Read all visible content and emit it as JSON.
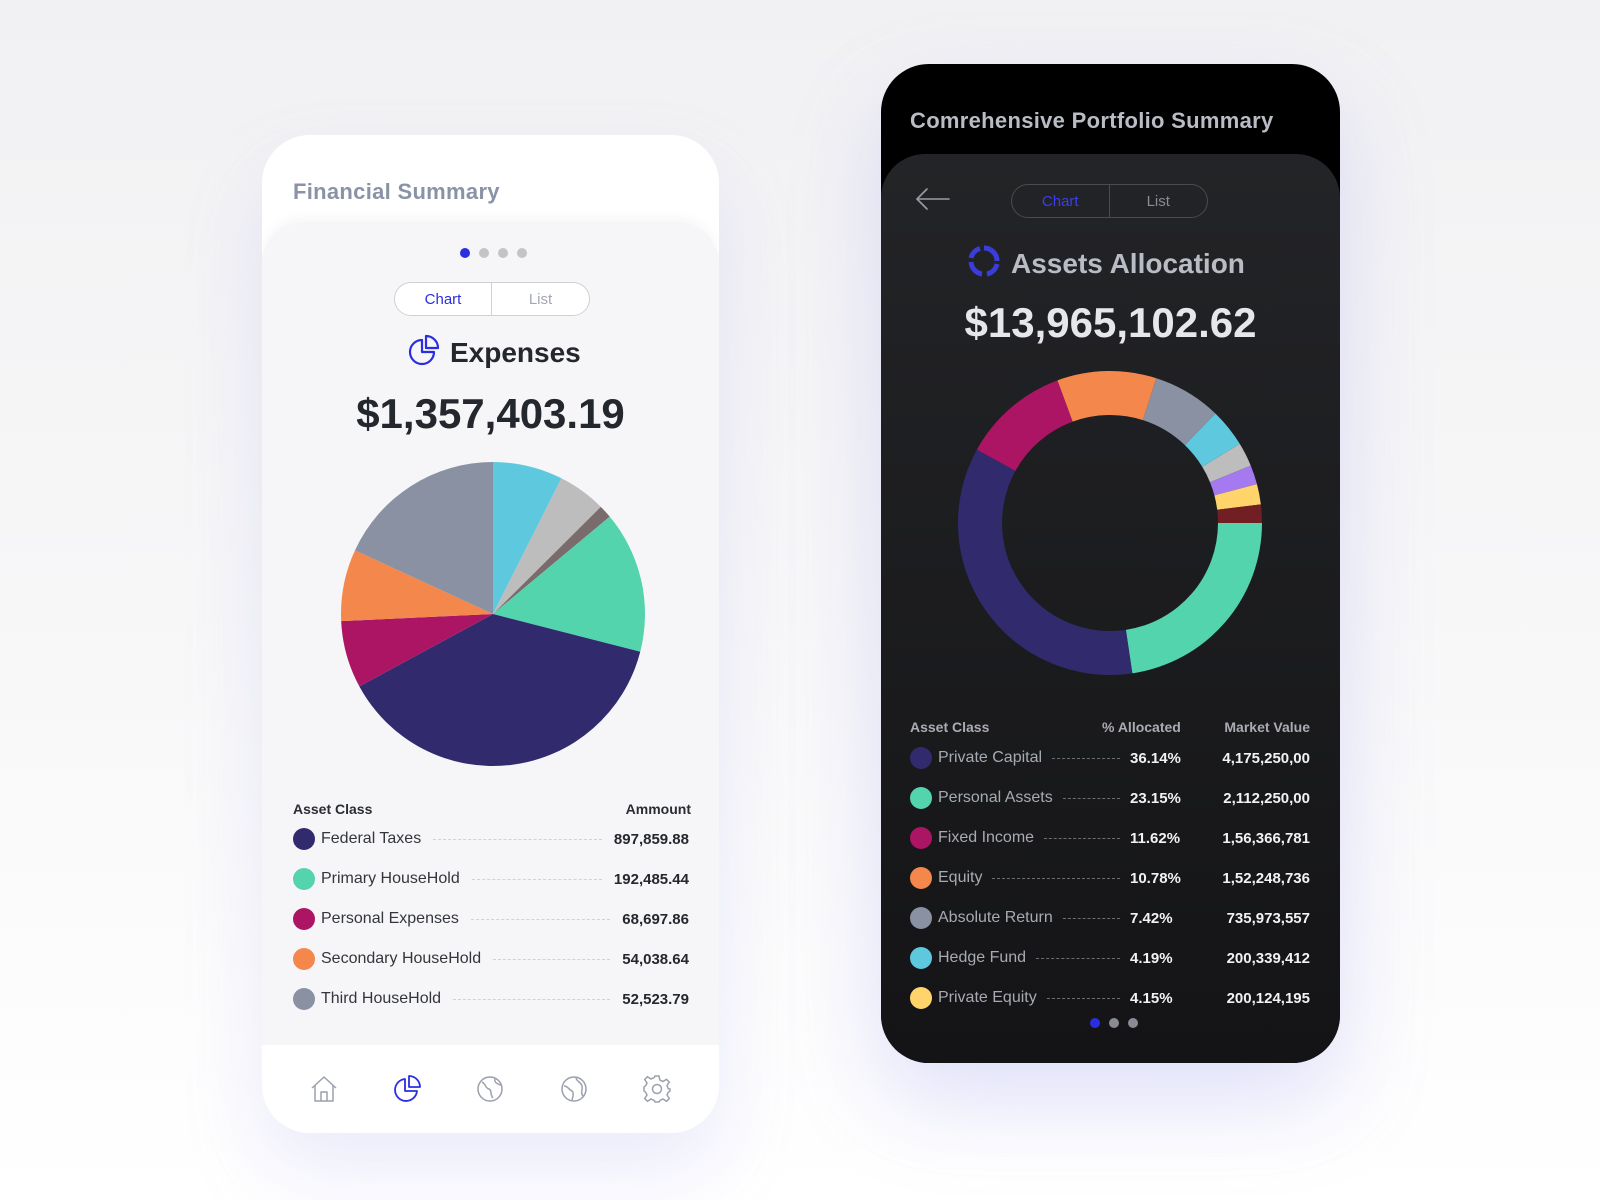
{
  "colors": {
    "accent": "#2b2ee0",
    "navy": "#312b6e",
    "teal": "#54d4ac",
    "magenta": "#ab1563",
    "orange": "#f4874b",
    "slate": "#8991a2",
    "cyan": "#5ec8de",
    "silver": "#bdbdbd",
    "brown": "#7a6c6c",
    "yellow": "#ffd56b",
    "purple": "#a57af0",
    "maroon": "#711f22"
  },
  "left": {
    "title": "Financial Summary",
    "pager": {
      "count": 4,
      "active": 0
    },
    "toggle": {
      "chart": "Chart",
      "list": "List"
    },
    "heading_icon": "pie-chart-icon",
    "heading": "Expenses",
    "total": "$1,357,403.19",
    "table": {
      "col_left": "Asset Class",
      "col_right": "Ammount"
    },
    "rows": [
      {
        "label": "Federal Taxes",
        "value": "897,859.88",
        "color": "#312b6e"
      },
      {
        "label": "Primary HouseHold",
        "value": "192,485.44",
        "color": "#54d4ac"
      },
      {
        "label": "Personal Expenses",
        "value": "68,697.86",
        "color": "#ab1563"
      },
      {
        "label": "Secondary HouseHold",
        "value": "54,038.64",
        "color": "#f4874b"
      },
      {
        "label": "Third HouseHold",
        "value": "52,523.79",
        "color": "#8991a2"
      }
    ],
    "tabbar": [
      "home-icon",
      "pie-chart-icon",
      "globe-icon",
      "globe-alt-icon",
      "gear-icon"
    ]
  },
  "right": {
    "title": "Comrehensive Portfolio Summary",
    "back_icon": "arrow-left-icon",
    "toggle": {
      "chart": "Chart",
      "list": "List"
    },
    "heading_icon": "donut-chart-icon",
    "heading": "Assets Allocation",
    "total": "$13,965,102.62",
    "table": {
      "col_class": "Asset Class",
      "col_pct": "% Allocated",
      "col_mv": "Market Value"
    },
    "rows": [
      {
        "label": "Private Capital",
        "pct": "36.14%",
        "mv": "4,175,250,00",
        "color": "#312b6e"
      },
      {
        "label": "Personal Assets",
        "pct": "23.15%",
        "mv": "2,112,250,00",
        "color": "#54d4ac"
      },
      {
        "label": "Fixed Income",
        "pct": "11.62%",
        "mv": "1,56,366,781",
        "color": "#ab1563"
      },
      {
        "label": "Equity",
        "pct": "10.78%",
        "mv": "1,52,248,736",
        "color": "#f4874b"
      },
      {
        "label": "Absolute Return",
        "pct": "7.42%",
        "mv": "735,973,557",
        "color": "#8991a2"
      },
      {
        "label": "Hedge Fund",
        "pct": "4.19%",
        "mv": "200,339,412",
        "color": "#5ec8de"
      },
      {
        "label": "Private Equity",
        "pct": "4.15%",
        "mv": "200,124,195",
        "color": "#ffd56b"
      }
    ],
    "pager": {
      "count": 3,
      "active": 0
    }
  },
  "chart_data": [
    {
      "type": "pie",
      "title": "Expenses",
      "categories": [
        "Federal Taxes",
        "Primary HouseHold",
        "Personal Expenses",
        "Secondary HouseHold",
        "Third HouseHold",
        "",
        "",
        ""
      ],
      "values": [
        897859.88,
        192485.44,
        68697.86,
        54038.64,
        52523.79,
        21000,
        8000,
        63000
      ],
      "colors": [
        "#312b6e",
        "#54d4ac",
        "#ab1563",
        "#f4874b",
        "#8991a2",
        "#bdbdbd",
        "#7a6c6c",
        "#5ec8de"
      ],
      "start_angle_deg": 0,
      "order": [
        "#5ec8de",
        "#bdbdbd",
        "#7a6c6c",
        "#54d4ac",
        "#312b6e",
        "#ab1563",
        "#f4874b",
        "#8991a2"
      ],
      "order_values": [
        8.0,
        5.5,
        1.5,
        16.2,
        41.0,
        7.7,
        8.2,
        19.5
      ]
    },
    {
      "type": "pie",
      "title": "Assets Allocation",
      "categories": [
        "Personal Assets",
        "Private Capital",
        "Fixed Income",
        "Equity",
        "Absolute Return",
        "Hedge Fund",
        "",
        "",
        "",
        ""
      ],
      "values": [
        23.15,
        36.14,
        11.62,
        10.78,
        7.42,
        4.19,
        2.6,
        2.1,
        2.2,
        2.0
      ],
      "colors": [
        "#54d4ac",
        "#312b6e",
        "#ab1563",
        "#f4874b",
        "#8991a2",
        "#5ec8de",
        "#bdbdbd",
        "#a57af0",
        "#ffd56b",
        "#711f22"
      ],
      "donut": true
    }
  ]
}
